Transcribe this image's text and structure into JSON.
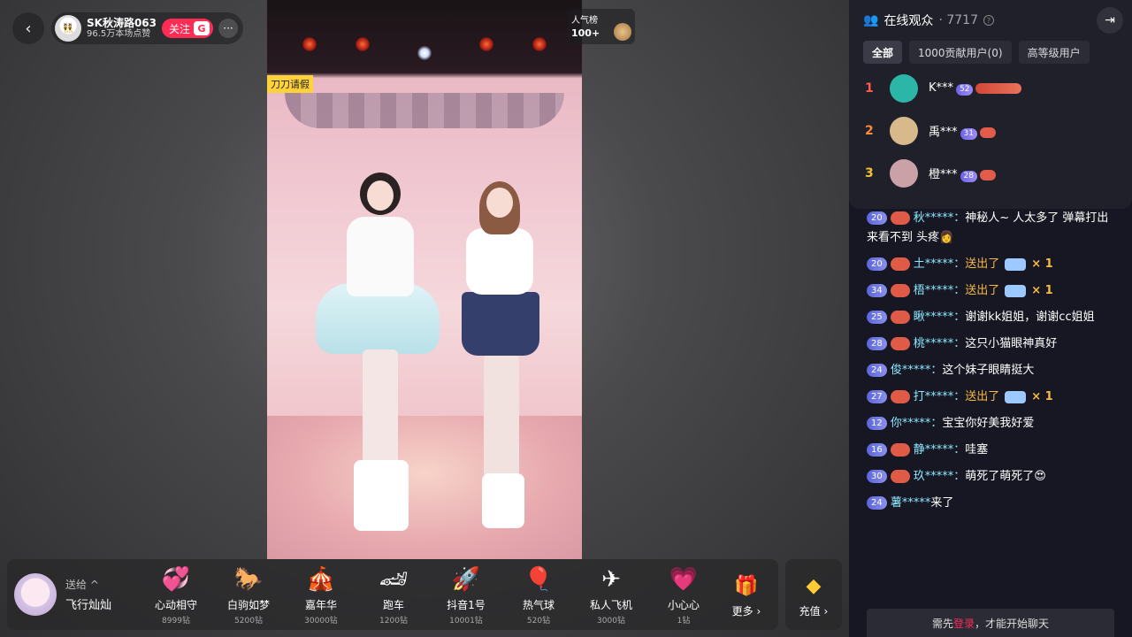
{
  "top": {
    "back_icon": "chevron-left-icon",
    "anchor_name": "SK秋涛路063",
    "anchor_likes": "96.5万本场点赞",
    "follow_label": "关注",
    "follow_badge": "G",
    "more_icon": "ellipsis-icon",
    "popular_label": "人气榜",
    "popular_value": "100+"
  },
  "video": {
    "tag": "刀刀请假"
  },
  "gift_bar": {
    "send_label": "送给",
    "send_name": "飞行灿灿",
    "gifts": [
      {
        "name": "心动相守",
        "price": "8999钻",
        "icon": "💞"
      },
      {
        "name": "白驹如梦",
        "price": "5200钻",
        "icon": "🐎"
      },
      {
        "name": "嘉年华",
        "price": "30000钻",
        "icon": "🎪"
      },
      {
        "name": "跑车",
        "price": "1200钻",
        "icon": "🏎"
      },
      {
        "name": "抖音1号",
        "price": "10001钻",
        "icon": "🚀"
      },
      {
        "name": "热气球",
        "price": "520钻",
        "icon": "🎈"
      },
      {
        "name": "私人飞机",
        "price": "3000钻",
        "icon": "✈"
      },
      {
        "name": "小心心",
        "price": "1钻",
        "icon": "💗"
      }
    ],
    "more_label": "更多",
    "more_icon": "gift-box-icon",
    "recharge_label": "充值",
    "recharge_icon": "diamond-icon"
  },
  "audience": {
    "title": "在线观众",
    "count": "7717",
    "tabs": [
      "全部",
      "1000贡献用户(0)",
      "高等级用户"
    ],
    "list": [
      {
        "rank": "1",
        "name": "K***",
        "level": "52",
        "rank_color": "#ff5a4e",
        "avatar_color": "#2bb6a7",
        "long_badge": true
      },
      {
        "rank": "2",
        "name": "禹***",
        "level": "31",
        "rank_color": "#ff8a3c",
        "avatar_color": "#d8b98c",
        "long_badge": false
      },
      {
        "rank": "3",
        "name": "橙***",
        "level": "28",
        "rank_color": "#f6c02f",
        "avatar_color": "#c9a1a6",
        "long_badge": false
      }
    ]
  },
  "chat": {
    "messages": [
      {
        "level": "20",
        "user": "秋*****：",
        "text": "神秘人~ 人太多了 弹幕打出来看不到 头疼👩",
        "gift": false,
        "fan": true
      },
      {
        "level": "20",
        "user": "土*****：",
        "text": "送出了",
        "gift": true,
        "mult": "× 1",
        "fan": true
      },
      {
        "level": "34",
        "user": "梧*****：",
        "text": "送出了",
        "gift": true,
        "mult": "× 1",
        "fan": true
      },
      {
        "level": "25",
        "user": "瞅*****：",
        "text": "谢谢kk姐姐，谢谢cc姐姐",
        "gift": false,
        "fan": true
      },
      {
        "level": "28",
        "user": "桃*****：",
        "text": "这只小猫眼神真好",
        "gift": false,
        "fan": true
      },
      {
        "level": "24",
        "user": "俊*****：",
        "text": "这个妹子眼睛挺大",
        "gift": false,
        "fan": false
      },
      {
        "level": "27",
        "user": "打*****：",
        "text": "送出了",
        "gift": true,
        "mult": "× 1",
        "fan": true
      },
      {
        "level": "12",
        "user": "你*****：",
        "text": "宝宝你好美我好爱",
        "gift": false,
        "fan": false
      },
      {
        "level": "16",
        "user": "静*****：",
        "text": "哇塞",
        "gift": false,
        "fan": true
      },
      {
        "level": "30",
        "user": "玖*****：",
        "text": "萌死了萌死了😍",
        "gift": false,
        "fan": true
      },
      {
        "level": "24",
        "user": "薯*****",
        "text": "来了",
        "gift": false,
        "fan": false
      }
    ],
    "footer_prefix": "需先",
    "footer_link": "登录",
    "footer_suffix": "，才能开始聊天"
  },
  "colors": {
    "accent": "#fe2c55",
    "gift_text": "#f7ba45",
    "username": "#8ce7ff",
    "panel_bg": "#161722"
  }
}
